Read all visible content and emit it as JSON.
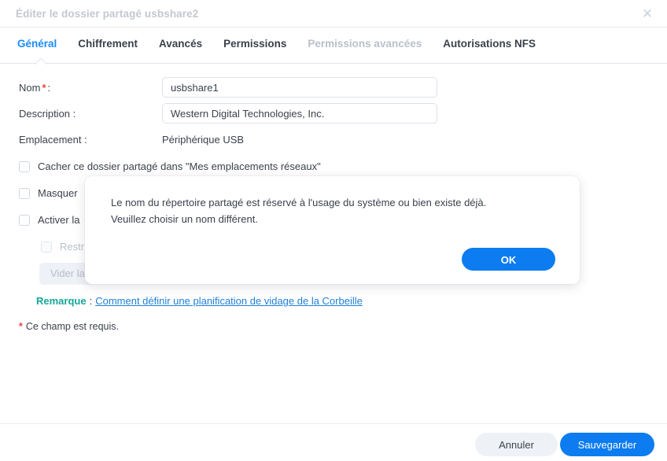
{
  "window": {
    "title": "Éditer le dossier partagé usbshare2",
    "close_icon": "close-icon",
    "close_glyph": "✕"
  },
  "tabs": [
    {
      "label": "Général",
      "state": "active"
    },
    {
      "label": "Chiffrement",
      "state": "normal"
    },
    {
      "label": "Avancés",
      "state": "normal"
    },
    {
      "label": "Permissions",
      "state": "normal"
    },
    {
      "label": "Permissions avancées",
      "state": "disabled"
    },
    {
      "label": "Autorisations NFS",
      "state": "normal"
    }
  ],
  "form": {
    "name": {
      "label": "Nom",
      "required_marker": "*",
      "colon": ":",
      "value": "usbshare1"
    },
    "description": {
      "label": "Description :",
      "value": "Western Digital Technologies, Inc."
    },
    "location": {
      "label": "Emplacement :",
      "value": "Périphérique USB"
    },
    "checkboxes": [
      {
        "label": "Cacher ce dossier partagé dans \"Mes emplacements réseaux\"",
        "checked": false,
        "disabled": false
      },
      {
        "label": "Masquer",
        "checked": false,
        "disabled": false
      },
      {
        "label": "Activer la",
        "checked": false,
        "disabled": false
      },
      {
        "label": "Restr",
        "checked": false,
        "disabled": true
      }
    ],
    "empty_recycle_button": {
      "label": "Vider la",
      "disabled": true
    },
    "remark": {
      "label": "Remarque",
      "colon": ":",
      "link_text": "Comment définir une planification de vidage de la Corbeille"
    },
    "required_note": {
      "marker": "*",
      "text": "Ce champ est requis."
    }
  },
  "footer": {
    "cancel_label": "Annuler",
    "save_label": "Sauvegarder"
  },
  "modal": {
    "message_line1": "Le nom du répertoire partagé est réservé à l'usage du système ou bien existe déjà.",
    "message_line2": "Veuillez choisir un nom différent.",
    "ok_label": "OK"
  },
  "colors": {
    "accent_blue": "#0c7cf0",
    "tab_active": "#1a8cff",
    "link_blue": "#1f7fd6",
    "remark_teal": "#16a79a",
    "required_red": "#e8453c",
    "text": "#3b414c",
    "muted": "#b9c0cb",
    "title_muted": "#c3c8d0",
    "border": "#dde2e9"
  }
}
